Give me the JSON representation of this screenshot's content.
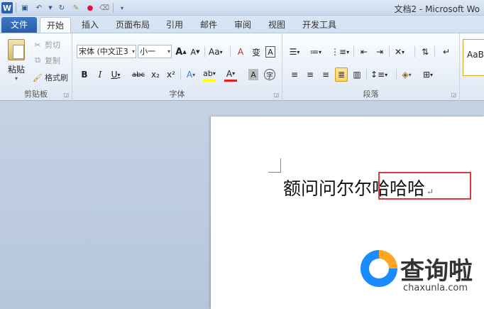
{
  "titlebar": {
    "app_icon": "W",
    "title": "文档2 - Microsoft Wo",
    "icons": [
      "save-icon",
      "undo-icon",
      "redo-icon",
      "format-painter-icon",
      "color-icon",
      "eraser-icon",
      "customize-icon"
    ]
  },
  "tabs": [
    "文件",
    "开始",
    "插入",
    "页面布局",
    "引用",
    "邮件",
    "审阅",
    "视图",
    "开发工具"
  ],
  "clipboard": {
    "paste": "粘贴",
    "cut": "剪切",
    "copy": "复制",
    "format_painter": "格式刷",
    "label": "剪贴板"
  },
  "font": {
    "font_name": "宋体 (中文正3",
    "font_size": "小一",
    "grow": "A",
    "shrink": "A",
    "case": "Aa",
    "clear_format": "A",
    "phonetic": "变",
    "border_char": "A",
    "bold": "B",
    "italic": "I",
    "underline": "U",
    "strikethrough": "abc",
    "subscript": "x₂",
    "superscript": "x²",
    "text_effect": "A",
    "highlight": "ab",
    "font_color": "A",
    "char_shading": "A",
    "enclose": "字",
    "label": "字体"
  },
  "paragraph": {
    "label": "段落"
  },
  "styles": {
    "preview": "AaB"
  },
  "document": {
    "text_plain": "额问问尔尔",
    "text_selected": "哈哈哈",
    "para_mark": "↵"
  },
  "watermark": {
    "name": "查询啦",
    "url": "chaxunla.com"
  },
  "colors": {
    "file_tab": "#2a5ea8",
    "highlight_border": "#e0393b",
    "active_button": "#ffd35d"
  }
}
